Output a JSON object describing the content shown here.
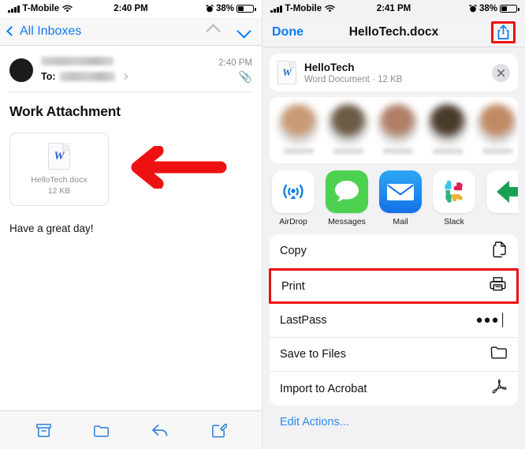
{
  "left": {
    "status": {
      "carrier": "T-Mobile",
      "time": "2:40 PM",
      "battery": "38%",
      "wifi_icon": "wifi-icon",
      "signal_icon": "signal-bars-icon",
      "alarm_icon": "alarm-clock-icon"
    },
    "nav": {
      "back_label": "All Inboxes",
      "up_icon": "chevron-up-icon",
      "down_icon": "chevron-down-icon"
    },
    "message": {
      "to_label": "To:",
      "time": "2:40 PM",
      "attachment_indicator_icon": "paperclip-icon",
      "subject": "Work Attachment",
      "body": "Have a great day!"
    },
    "attachment": {
      "file_name": "HelloTech.docx",
      "file_size": "12 KB",
      "icon": "word-document-icon"
    },
    "annotation": {
      "arrow_icon": "red-left-arrow-annotation",
      "color": "#ee1111"
    },
    "toolbar": [
      {
        "name": "archive-button",
        "icon": "archive-box-icon"
      },
      {
        "name": "move-to-folder-button",
        "icon": "folder-icon"
      },
      {
        "name": "reply-button",
        "icon": "reply-arrow-icon"
      },
      {
        "name": "compose-button",
        "icon": "compose-pencil-icon"
      }
    ]
  },
  "right": {
    "status": {
      "carrier": "T-Mobile",
      "time": "2:41 PM",
      "battery": "38%",
      "wifi_icon": "wifi-icon",
      "signal_icon": "signal-bars-icon",
      "alarm_icon": "alarm-clock-icon"
    },
    "nav": {
      "done_label": "Done",
      "title": "HelloTech.docx",
      "share_icon": "share-upload-icon",
      "share_highlight_color": "#ee1111"
    },
    "sheet_header": {
      "file_name": "HelloTech",
      "file_meta": "Word Document · 12 KB",
      "doc_icon": "word-document-icon",
      "close_icon": "close-x-icon"
    },
    "people": [
      {
        "name": "contact-avatar",
        "c1": "#c99a74",
        "c2": "#5fcf7e"
      },
      {
        "name": "contact-avatar",
        "c1": "#6b5a44",
        "c2": "#66c97f"
      },
      {
        "name": "contact-avatar",
        "c1": "#b07f66",
        "c2": "#6fd08a"
      },
      {
        "name": "contact-avatar",
        "c1": "#4a3a2c",
        "c2": "#5fc878"
      },
      {
        "name": "contact-avatar",
        "c1": "#c08a63",
        "c2": "#72cf87"
      }
    ],
    "apps": [
      {
        "label": "AirDrop",
        "icon": "airdrop-icon"
      },
      {
        "label": "Messages",
        "icon": "messages-icon"
      },
      {
        "label": "Mail",
        "icon": "mail-icon"
      },
      {
        "label": "Slack",
        "icon": "slack-icon"
      },
      {
        "label": "",
        "icon": "green-arrow-app-icon"
      }
    ],
    "actions": [
      {
        "label": "Copy",
        "icon": "copy-pages-icon",
        "highlighted": false
      },
      {
        "label": "Print",
        "icon": "printer-icon",
        "highlighted": true
      },
      {
        "label": "LastPass",
        "icon": "password-dots-icon",
        "highlighted": false
      },
      {
        "label": "Save to Files",
        "icon": "folder-icon",
        "highlighted": false
      },
      {
        "label": "Import to Acrobat",
        "icon": "acrobat-icon",
        "highlighted": false
      }
    ],
    "edit_actions_label": "Edit Actions..."
  }
}
